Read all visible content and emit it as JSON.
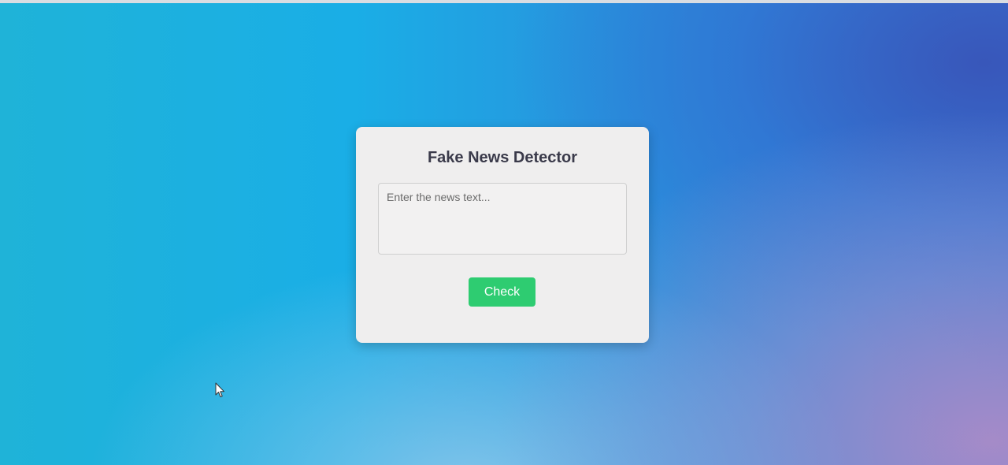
{
  "app": {
    "title": "Fake News Detector"
  },
  "form": {
    "input_value": "",
    "input_placeholder": "Enter the news text...",
    "check_label": "Check"
  },
  "colors": {
    "card_background": "#efeeee",
    "button_background": "#2ecc71",
    "title_text": "#3a3a4a"
  },
  "icons": {
    "cursor": "mouse-pointer-icon"
  }
}
